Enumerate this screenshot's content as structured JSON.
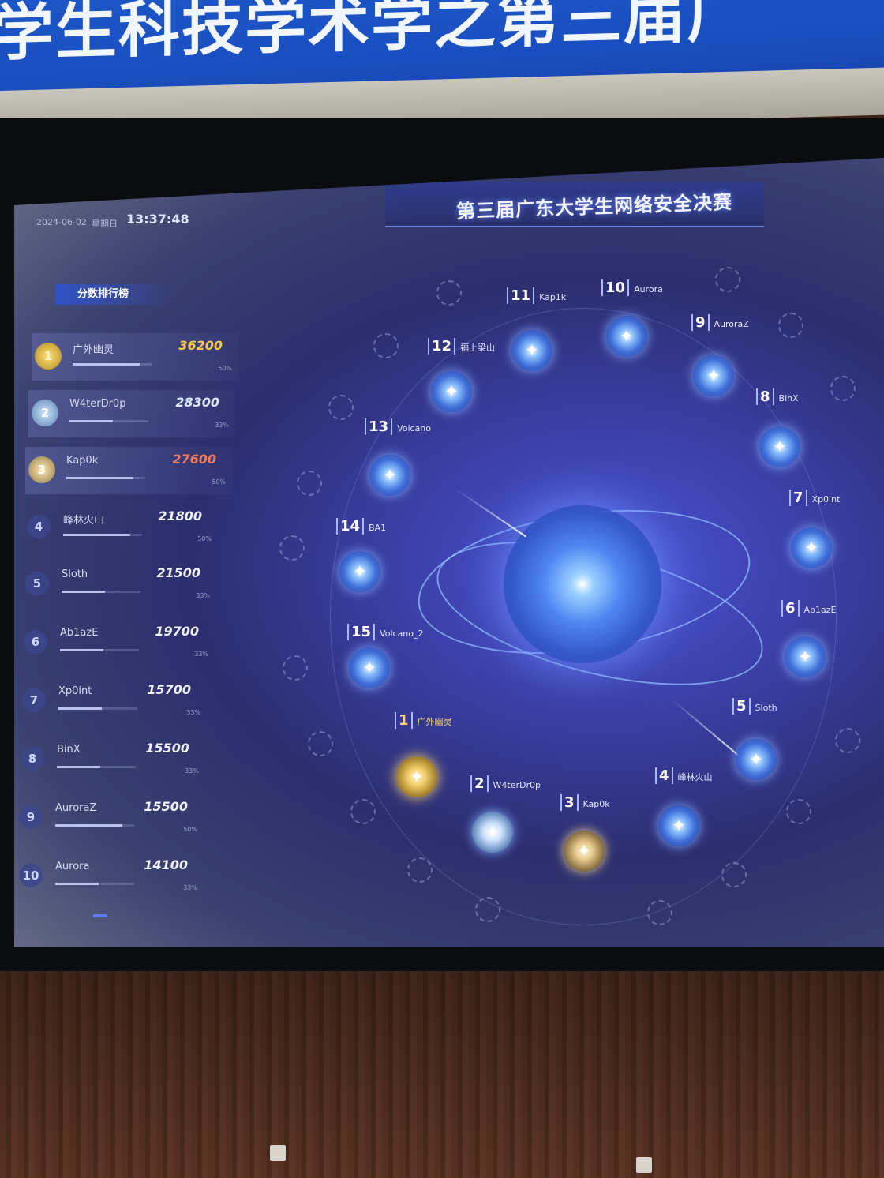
{
  "banner": {
    "text": "学生科技学术学之第三届广"
  },
  "screen": {
    "date": "2024-06-02",
    "weekday": "星期日",
    "time": "13:37:48",
    "title": "第三届广东大学生网络安全决赛"
  },
  "leaderboard": {
    "title": "分数排行榜",
    "rows": [
      {
        "rank": "1",
        "name": "广外幽灵",
        "score": "36200",
        "pct": "50%",
        "fill": 0.85
      },
      {
        "rank": "2",
        "name": "W4terDr0p",
        "score": "28300",
        "pct": "33%",
        "fill": 0.55
      },
      {
        "rank": "3",
        "name": "Kap0k",
        "score": "27600",
        "pct": "50%",
        "fill": 0.85
      },
      {
        "rank": "4",
        "name": "峰林火山",
        "score": "21800",
        "pct": "50%",
        "fill": 0.85
      },
      {
        "rank": "5",
        "name": "Sloth",
        "score": "21500",
        "pct": "33%",
        "fill": 0.55
      },
      {
        "rank": "6",
        "name": "Ab1azE",
        "score": "19700",
        "pct": "33%",
        "fill": 0.55
      },
      {
        "rank": "7",
        "name": "Xp0int",
        "score": "15700",
        "pct": "33%",
        "fill": 0.55
      },
      {
        "rank": "8",
        "name": "BinX",
        "score": "15500",
        "pct": "33%",
        "fill": 0.55
      },
      {
        "rank": "9",
        "name": "AuroraZ",
        "score": "15500",
        "pct": "50%",
        "fill": 0.85
      },
      {
        "rank": "10",
        "name": "Aurora",
        "score": "14100",
        "pct": "33%",
        "fill": 0.55
      }
    ]
  },
  "teams": [
    {
      "num": "1",
      "name": "广外幽灵",
      "style": "gold"
    },
    {
      "num": "2",
      "name": "W4terDr0p",
      "style": "silver"
    },
    {
      "num": "3",
      "name": "Kap0k",
      "style": "bronze"
    },
    {
      "num": "4",
      "name": "峰林火山",
      "style": "blue"
    },
    {
      "num": "5",
      "name": "Sloth",
      "style": "blue"
    },
    {
      "num": "6",
      "name": "Ab1azE",
      "style": "blue"
    },
    {
      "num": "7",
      "name": "Xp0int",
      "style": "blue"
    },
    {
      "num": "8",
      "name": "BinX",
      "style": "blue"
    },
    {
      "num": "9",
      "name": "AuroraZ",
      "style": "blue"
    },
    {
      "num": "10",
      "name": "Aurora",
      "style": "blue"
    },
    {
      "num": "11",
      "name": "Kap1k",
      "style": "blue"
    },
    {
      "num": "12",
      "name": "福上梁山",
      "style": "blue"
    },
    {
      "num": "13",
      "name": "Volcano",
      "style": "blue"
    },
    {
      "num": "14",
      "name": "BA1",
      "style": "blue"
    },
    {
      "num": "15",
      "name": "Volcano_2",
      "style": "blue"
    }
  ]
}
